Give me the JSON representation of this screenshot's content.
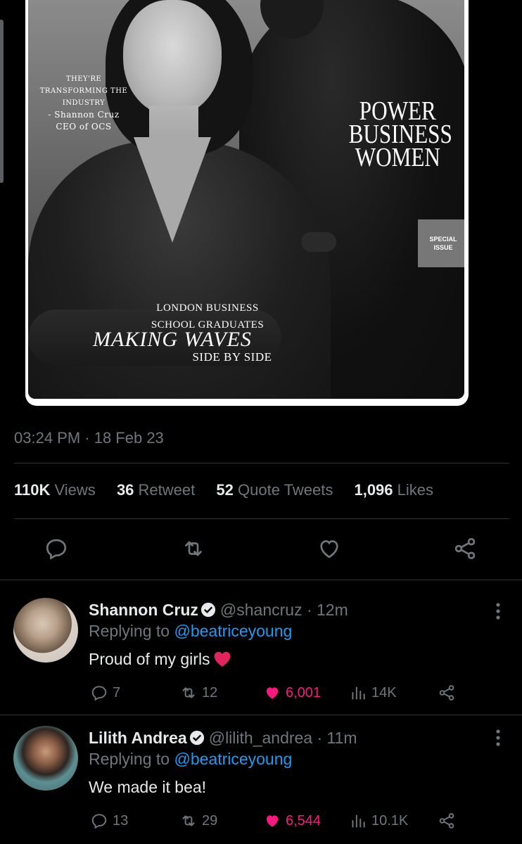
{
  "media": {
    "quote_lines": [
      "THEY'RE",
      "TRANSFORMING THE",
      "INDUSTRY",
      "- Shannon Cruz",
      "CEO of OCS"
    ],
    "headline_lines": [
      "POWER",
      "BUSINESS",
      "WOMEN"
    ],
    "badge_lines": [
      "SPECIAL",
      "ISSUE"
    ],
    "subline_1": "LONDON BUSINESS",
    "subline_2": "SCHOOL GRADUATES",
    "feature": "MAKING WAVES",
    "feature_sub": "SIDE BY SIDE"
  },
  "tweet": {
    "timestamp": "03:24 PM · 18 Feb 23",
    "stats": {
      "views_count": "110K",
      "views_label": "Views",
      "retweets_count": "36",
      "retweets_label": "Retweet",
      "quotes_count": "52",
      "quotes_label": "Quote Tweets",
      "likes_count": "1,096",
      "likes_label": "Likes"
    },
    "actions": [
      "reply-icon",
      "retweet-icon",
      "like-icon",
      "share-icon"
    ]
  },
  "replies": [
    {
      "name": "Shannon Cruz",
      "handle": "@shancruz",
      "time": "· 12m",
      "replying_label": "Replying to",
      "replying_to": "@beatriceyoung",
      "text": "Proud of my girls",
      "emoji": "red-heart",
      "replies": "7",
      "retweets": "12",
      "likes": "6,001",
      "views": "14K"
    },
    {
      "name": "Lilith Andrea",
      "handle": "@lilith_andrea",
      "time": "· 11m",
      "replying_label": "Replying to",
      "replying_to": "@beatriceyoung",
      "text": "We made it bea!",
      "replies": "13",
      "retweets": "29",
      "likes": "6,544",
      "views": "10.1K"
    }
  ],
  "colors": {
    "background": "#000000",
    "muted": "#71767b",
    "link": "#1d9bf0",
    "like": "#f91880",
    "divider": "#2f3336"
  }
}
